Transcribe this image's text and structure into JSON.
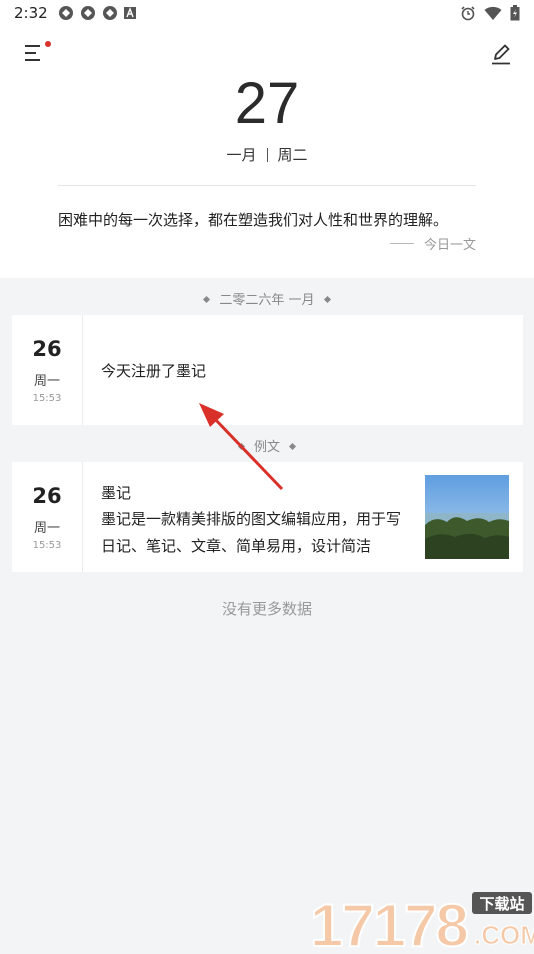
{
  "status_bar": {
    "time": "2:32",
    "icons": [
      "app-notification-icon",
      "app-notification-icon",
      "app-notification-icon",
      "a-icon"
    ],
    "right_icons": [
      "alarm-icon",
      "wifi-icon",
      "battery-icon"
    ]
  },
  "header": {
    "menu_icon": "menu-icon",
    "edit_icon": "edit-icon",
    "day": "27",
    "month": "一月",
    "weekday": "周二"
  },
  "quote": {
    "text": "困难中的每一次选择，都在塑造我们对人性和世界的理解。",
    "source": "今日一文"
  },
  "groups": [
    {
      "label": "二零二六年 一月",
      "entries": [
        {
          "day": "26",
          "weekday": "周一",
          "time": "15:53",
          "text": "今天注册了墨记"
        }
      ]
    },
    {
      "label": "例文",
      "entries": [
        {
          "day": "26",
          "weekday": "周一",
          "time": "15:53",
          "title": "墨记",
          "body": "墨记是一款精美排版的图文编辑应用，用于写日记、笔记、文章、简单易用，设计简洁"
        }
      ]
    }
  ],
  "footer": {
    "no_more": "没有更多数据"
  },
  "watermark": {
    "main": "17178",
    "tag": "下载站",
    "sub": ".COM"
  },
  "colors": {
    "accent_red": "#d9302a",
    "background": "#f3f4f6",
    "card": "#ffffff"
  }
}
